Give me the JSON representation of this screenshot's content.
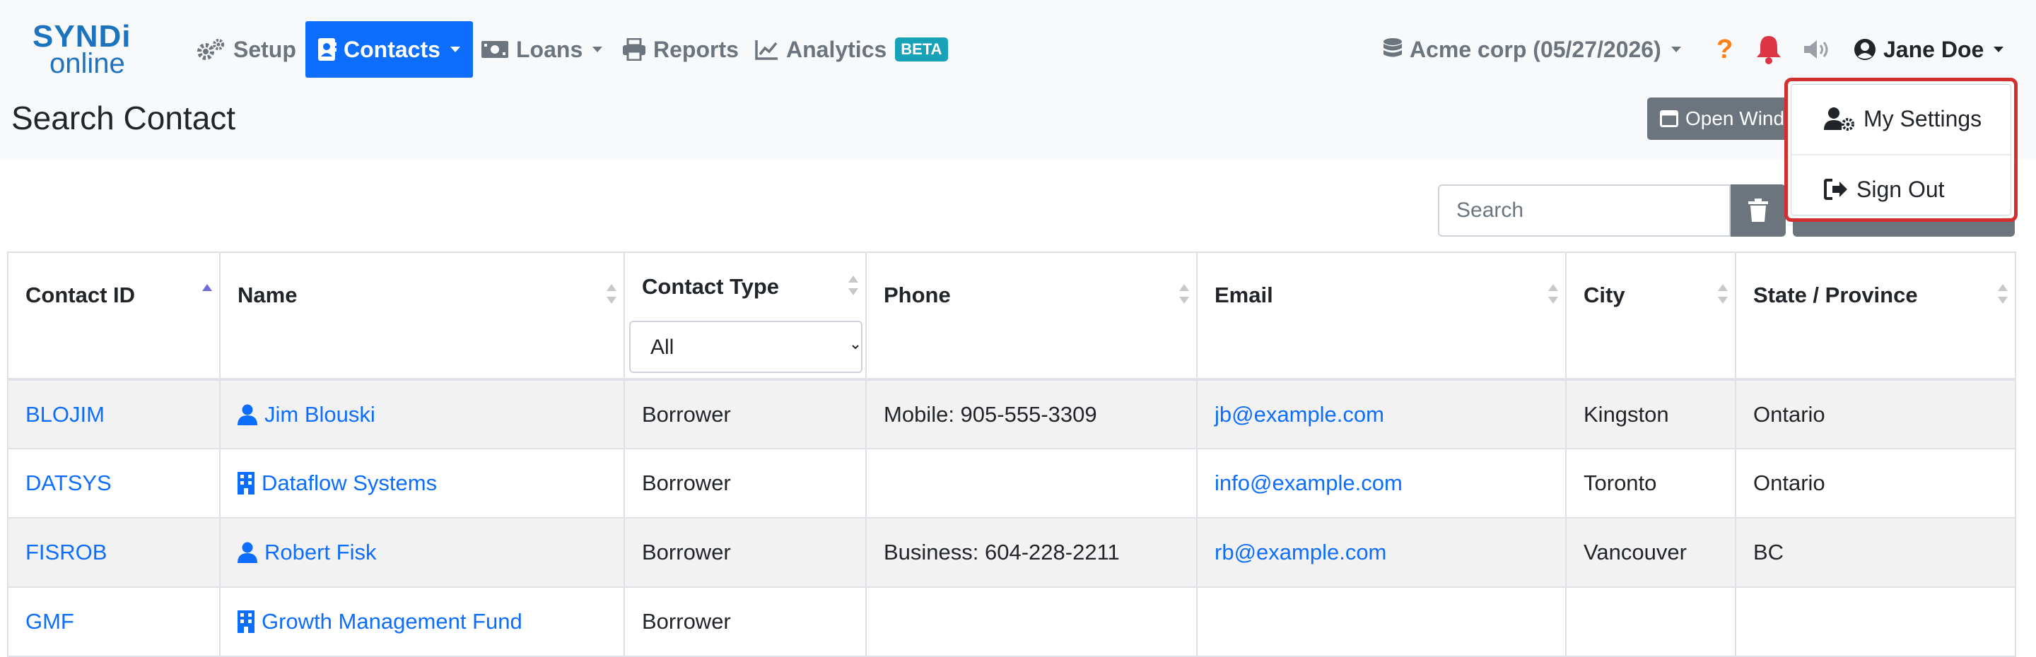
{
  "logo": {
    "line1": "SYNDi",
    "line2": "online"
  },
  "nav": {
    "setup": "Setup",
    "contacts": "Contacts",
    "loans": "Loans",
    "reports": "Reports",
    "analytics": "Analytics",
    "analytics_badge": "BETA"
  },
  "header": {
    "company": "Acme corp (05/27/2026)",
    "help": "?",
    "user": "Jane Doe"
  },
  "page": {
    "title": "Search Contact",
    "open_window_label": "Open Window"
  },
  "search": {
    "placeholder": "Search"
  },
  "table": {
    "headers": {
      "contact_id": "Contact ID",
      "name": "Name",
      "contact_type": "Contact Type",
      "phone": "Phone",
      "email": "Email",
      "city": "City",
      "state": "State / Province"
    },
    "type_filter": {
      "selected": "All"
    },
    "rows": [
      {
        "id": "BLOJIM",
        "name": "Jim Blouski",
        "kind": "person",
        "type": "Borrower",
        "phone": "Mobile: 905-555-3309",
        "email": "jb@example.com",
        "city": "Kingston",
        "state": "Ontario"
      },
      {
        "id": "DATSYS",
        "name": "Dataflow Systems",
        "kind": "company",
        "type": "Borrower",
        "phone": "",
        "email": "info@example.com",
        "city": "Toronto",
        "state": "Ontario"
      },
      {
        "id": "FISROB",
        "name": "Robert Fisk",
        "kind": "person",
        "type": "Borrower",
        "phone": "Business: 604-228-2211",
        "email": "rb@example.com",
        "city": "Vancouver",
        "state": "BC"
      },
      {
        "id": "GMF",
        "name": "Growth Management Fund",
        "kind": "company",
        "type": "Borrower",
        "phone": "",
        "email": "",
        "city": "",
        "state": ""
      }
    ]
  },
  "user_menu": {
    "my_settings": "My Settings",
    "sign_out": "Sign Out"
  },
  "colors": {
    "primary": "#0d6efd",
    "brand": "#1e73be",
    "warning": "#fd7e14",
    "danger": "#dc3545",
    "highlight": "#d32f2f"
  }
}
